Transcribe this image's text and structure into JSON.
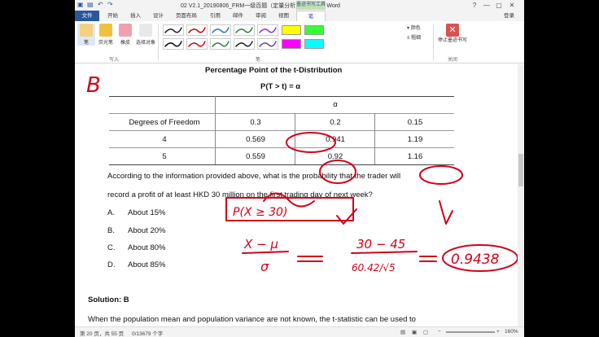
{
  "window": {
    "title": "02 V2.1_20190806_FRM一级百题（定量分析）_授课版 - Word",
    "help": "?",
    "minimize": "—",
    "restore": "▢",
    "close": "✕"
  },
  "ribbon_tabs": {
    "context_label": "墨迹书写工具",
    "file": "文件",
    "tabs": [
      "开始",
      "插入",
      "设计",
      "页面布局",
      "引用",
      "邮件",
      "审阅",
      "视图"
    ],
    "pen": "笔",
    "login": "登录"
  },
  "ribbon": {
    "write_group": "写入",
    "pen_group": "笔",
    "close_group": "关闭",
    "pen_btn": "笔",
    "highlighter_btn": "荧光笔",
    "eraser_btn": "橡皮",
    "select_btn": "选择对象",
    "color": "颜色",
    "thickness": "粗细",
    "stop_btn": "停止墨迹书写",
    "pen_colors": [
      "#1a1a1a",
      "#c00000",
      "#1f6fd0",
      "#2e7d32",
      "#8a2be2",
      "#000000",
      "#d0021b",
      "#2e7d32",
      "#1a1a1a",
      "#6b3fa0"
    ],
    "highlight_colors": [
      "#ffff00",
      "#33ff33",
      "#ff00ff",
      "#00ffff"
    ]
  },
  "document": {
    "table_title": "Percentage Point of the t-Distribution",
    "prob_expr": "P(T > t) = α",
    "alpha": "α",
    "header_label": "Degrees of Freedom",
    "columns": [
      "0.3",
      "0.2",
      "0.15"
    ],
    "rows": [
      {
        "df": "4",
        "values": [
          "0.569",
          "0.941",
          "1.19"
        ]
      },
      {
        "df": "5",
        "values": [
          "0.559",
          "0.92",
          "1.16"
        ]
      }
    ],
    "question_line1": "According to the information provided above, what is the probability that the trader will",
    "question_line2": "record a profit of at least HKD 30 million on the first trading day of next week?",
    "options": [
      {
        "letter": "A.",
        "text": "About 15%"
      },
      {
        "letter": "B.",
        "text": "About 20%"
      },
      {
        "letter": "C.",
        "text": "About 80%"
      },
      {
        "letter": "D.",
        "text": "About 85%"
      }
    ],
    "solution": "Solution: B",
    "bottom_line": "When the population mean and population variance are not known, the t-statistic can be used to"
  },
  "ink": {
    "answer_mark": "B",
    "formula_top": "P(X ≥ 30)",
    "formula_left": "X − μ",
    "formula_left_den": "σ",
    "formula_mid": "30 − 45",
    "formula_mid_den": "60.42/√5",
    "result": "0.9438",
    "ink_color": "#d0021b"
  },
  "status": {
    "page": "第 20 页，共 55 页",
    "words": "0/13679 个字",
    "zoom": "160%"
  }
}
